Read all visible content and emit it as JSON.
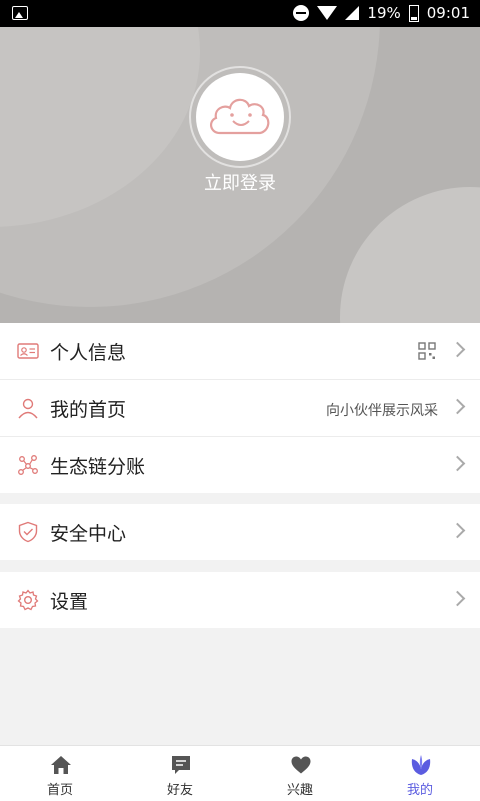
{
  "status_bar": {
    "battery": "19%",
    "time": "09:01"
  },
  "profile": {
    "login_label": "立即登录"
  },
  "menu": {
    "group1": [
      {
        "label": "个人信息",
        "sub": "",
        "icon": "id-card-icon"
      },
      {
        "label": "我的首页",
        "sub": "向小伙伴展示风采",
        "icon": "user-icon"
      },
      {
        "label": "生态链分账",
        "sub": "",
        "icon": "network-icon"
      }
    ],
    "group2": [
      {
        "label": "安全中心",
        "sub": "",
        "icon": "shield-icon"
      }
    ],
    "group3": [
      {
        "label": "设置",
        "sub": "",
        "icon": "gear-icon"
      }
    ]
  },
  "tabs": [
    {
      "label": "首页",
      "icon": "home-icon"
    },
    {
      "label": "好友",
      "icon": "chat-icon"
    },
    {
      "label": "兴趣",
      "icon": "heart-icon"
    },
    {
      "label": "我的",
      "icon": "leaf-icon"
    }
  ],
  "colors": {
    "accent": "#5b5ce0",
    "icon_red": "#e07a78",
    "header_bg": "#b5b3b1"
  }
}
